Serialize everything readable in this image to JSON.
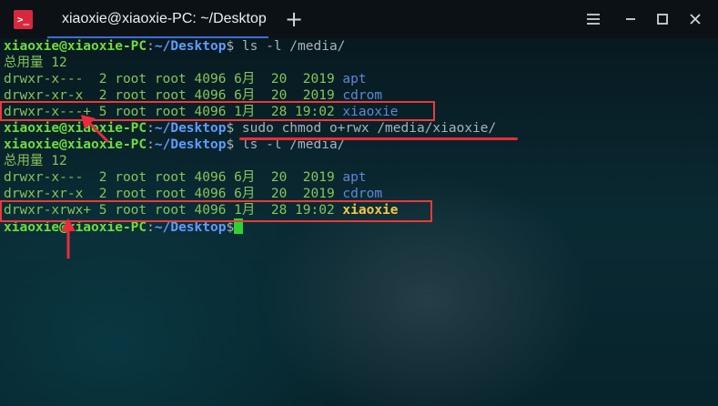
{
  "window": {
    "tab_title": "xiaoxie@xiaoxie-PC: ~/Desktop",
    "app_icon_glyph": ">_",
    "new_tab_glyph": "+"
  },
  "terminal": {
    "prompt_user": "xiaoxie@xiaoxie-PC",
    "prompt_sep": ":",
    "prompt_path": "~/Desktop",
    "prompt_end": "$",
    "total_line": "总用量 12",
    "cmd1": " ls -l /media/",
    "cmd2": " sudo chmod o+rwx /media/xiaoxie/",
    "cmd3": " ls -l /media/",
    "listing1": [
      {
        "meta": "drwxr-x---  2 root root 4096 6月  20  2019 ",
        "name": "apt"
      },
      {
        "meta": "drwxr-xr-x  2 root root 4096 6月  20  2019 ",
        "name": "cdrom"
      },
      {
        "meta": "drwxr-x---+ 5 root root 4096 1月  28 19:02 ",
        "name": "xiaoxie"
      }
    ],
    "listing2": [
      {
        "meta": "drwxr-x---  2 root root 4096 6月  20  2019 ",
        "name": "apt"
      },
      {
        "meta": "drwxr-xr-x  2 root root 4096 6月  20  2019 ",
        "name": "cdrom"
      },
      {
        "meta": "drwxr-xrwx+ 5 root root 4096 1月  28 19:02 ",
        "name": "xiaoxie"
      }
    ]
  },
  "colors": {
    "annotation": "#ea3a3a",
    "prompt_user": "#6fdc3c",
    "prompt_path": "#5f9cff",
    "highlight_dir": "#f2c744",
    "tab_underline": "#3a6ed8",
    "app_icon": "#d9283d"
  }
}
